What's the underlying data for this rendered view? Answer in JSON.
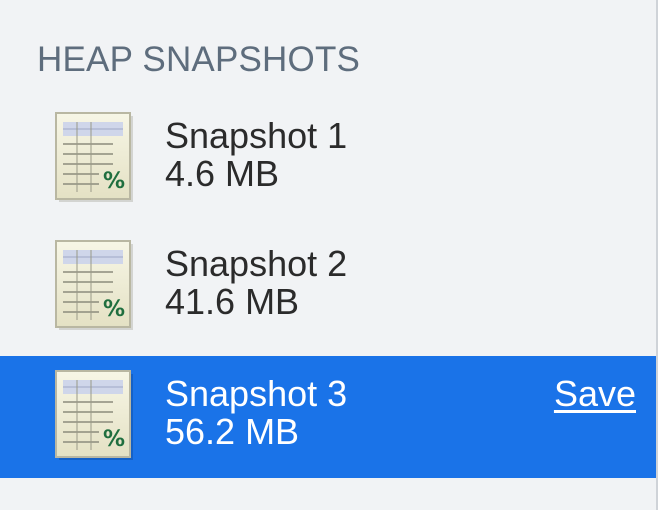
{
  "sidebar": {
    "section_title": "HEAP SNAPSHOTS",
    "items": [
      {
        "name": "Snapshot 1",
        "size": "4.6 MB",
        "icon": "heap-snapshot-icon",
        "selected": false
      },
      {
        "name": "Snapshot 2",
        "size": "41.6 MB",
        "icon": "heap-snapshot-icon",
        "selected": false
      },
      {
        "name": "Snapshot 3",
        "size": "56.2 MB",
        "icon": "heap-snapshot-icon",
        "selected": true,
        "action_label": "Save"
      }
    ]
  },
  "colors": {
    "panel_background": "#f1f3f5",
    "selection": "#1a73e8",
    "section_title": "#5e6d7d"
  }
}
